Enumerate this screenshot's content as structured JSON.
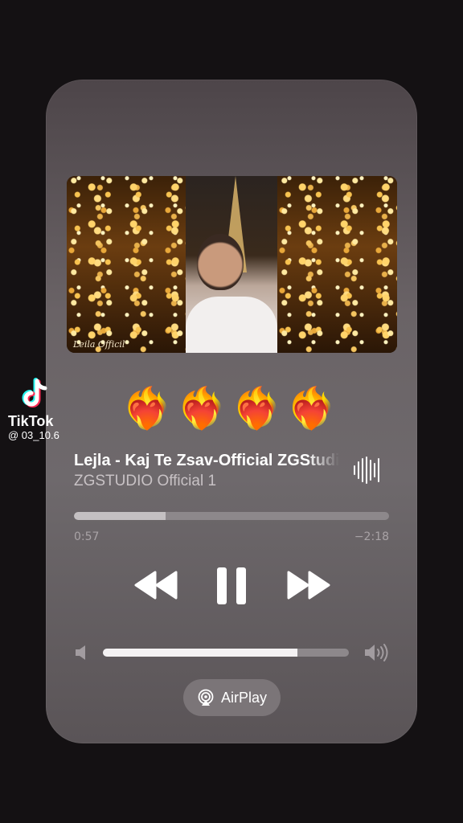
{
  "overlay": {
    "app_name": "TikTok",
    "handle": "@ 03_10.6"
  },
  "artwork": {
    "signature": "Leila Officil"
  },
  "emoji_row": "❤️‍🔥❤️‍🔥❤️‍🔥❤️‍🔥",
  "track": {
    "title": "Lejla - Kaj Te Zsav-Official ZGStudio",
    "artist": "ZGSTUDIO Official 1"
  },
  "playback": {
    "elapsed": "0:57",
    "remaining": "−2:18",
    "progress_fraction": 0.29
  },
  "volume": {
    "level_fraction": 0.79
  },
  "airplay": {
    "label": "AirPlay"
  },
  "icons": {
    "rewind": "rewind-icon",
    "pause": "pause-icon",
    "forward": "fast-forward-icon",
    "volume_low": "speaker-low-icon",
    "volume_high": "speaker-high-icon",
    "airplay": "airplay-icon",
    "waveform": "waveform-icon",
    "tiktok": "tiktok-logo-icon"
  },
  "colors": {
    "card": "#6a6366",
    "track": "#8d888b",
    "fill": "#c4c0c2"
  }
}
